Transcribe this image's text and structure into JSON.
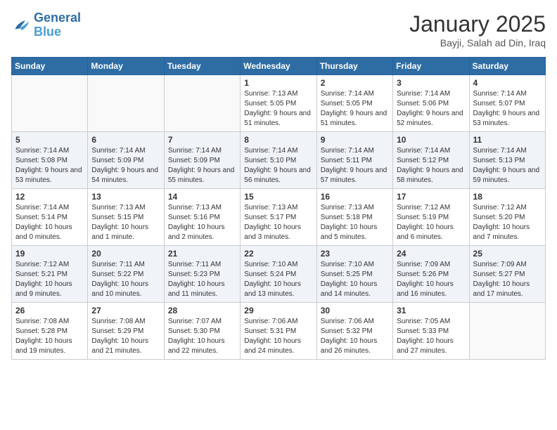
{
  "header": {
    "logo_general": "General",
    "logo_blue": "Blue",
    "month": "January 2025",
    "location": "Bayji, Salah ad Din, Iraq"
  },
  "weekdays": [
    "Sunday",
    "Monday",
    "Tuesday",
    "Wednesday",
    "Thursday",
    "Friday",
    "Saturday"
  ],
  "weeks": [
    [
      {
        "day": "",
        "empty": true
      },
      {
        "day": "",
        "empty": true
      },
      {
        "day": "",
        "empty": true
      },
      {
        "day": "1",
        "sunrise": "7:13 AM",
        "sunset": "5:05 PM",
        "daylight": "9 hours and 51 minutes."
      },
      {
        "day": "2",
        "sunrise": "7:14 AM",
        "sunset": "5:05 PM",
        "daylight": "9 hours and 51 minutes."
      },
      {
        "day": "3",
        "sunrise": "7:14 AM",
        "sunset": "5:06 PM",
        "daylight": "9 hours and 52 minutes."
      },
      {
        "day": "4",
        "sunrise": "7:14 AM",
        "sunset": "5:07 PM",
        "daylight": "9 hours and 53 minutes."
      }
    ],
    [
      {
        "day": "5",
        "sunrise": "7:14 AM",
        "sunset": "5:08 PM",
        "daylight": "9 hours and 53 minutes."
      },
      {
        "day": "6",
        "sunrise": "7:14 AM",
        "sunset": "5:09 PM",
        "daylight": "9 hours and 54 minutes."
      },
      {
        "day": "7",
        "sunrise": "7:14 AM",
        "sunset": "5:09 PM",
        "daylight": "9 hours and 55 minutes."
      },
      {
        "day": "8",
        "sunrise": "7:14 AM",
        "sunset": "5:10 PM",
        "daylight": "9 hours and 56 minutes."
      },
      {
        "day": "9",
        "sunrise": "7:14 AM",
        "sunset": "5:11 PM",
        "daylight": "9 hours and 57 minutes."
      },
      {
        "day": "10",
        "sunrise": "7:14 AM",
        "sunset": "5:12 PM",
        "daylight": "9 hours and 58 minutes."
      },
      {
        "day": "11",
        "sunrise": "7:14 AM",
        "sunset": "5:13 PM",
        "daylight": "9 hours and 59 minutes."
      }
    ],
    [
      {
        "day": "12",
        "sunrise": "7:14 AM",
        "sunset": "5:14 PM",
        "daylight": "10 hours and 0 minutes."
      },
      {
        "day": "13",
        "sunrise": "7:13 AM",
        "sunset": "5:15 PM",
        "daylight": "10 hours and 1 minute."
      },
      {
        "day": "14",
        "sunrise": "7:13 AM",
        "sunset": "5:16 PM",
        "daylight": "10 hours and 2 minutes."
      },
      {
        "day": "15",
        "sunrise": "7:13 AM",
        "sunset": "5:17 PM",
        "daylight": "10 hours and 3 minutes."
      },
      {
        "day": "16",
        "sunrise": "7:13 AM",
        "sunset": "5:18 PM",
        "daylight": "10 hours and 5 minutes."
      },
      {
        "day": "17",
        "sunrise": "7:12 AM",
        "sunset": "5:19 PM",
        "daylight": "10 hours and 6 minutes."
      },
      {
        "day": "18",
        "sunrise": "7:12 AM",
        "sunset": "5:20 PM",
        "daylight": "10 hours and 7 minutes."
      }
    ],
    [
      {
        "day": "19",
        "sunrise": "7:12 AM",
        "sunset": "5:21 PM",
        "daylight": "10 hours and 9 minutes."
      },
      {
        "day": "20",
        "sunrise": "7:11 AM",
        "sunset": "5:22 PM",
        "daylight": "10 hours and 10 minutes."
      },
      {
        "day": "21",
        "sunrise": "7:11 AM",
        "sunset": "5:23 PM",
        "daylight": "10 hours and 11 minutes."
      },
      {
        "day": "22",
        "sunrise": "7:10 AM",
        "sunset": "5:24 PM",
        "daylight": "10 hours and 13 minutes."
      },
      {
        "day": "23",
        "sunrise": "7:10 AM",
        "sunset": "5:25 PM",
        "daylight": "10 hours and 14 minutes."
      },
      {
        "day": "24",
        "sunrise": "7:09 AM",
        "sunset": "5:26 PM",
        "daylight": "10 hours and 16 minutes."
      },
      {
        "day": "25",
        "sunrise": "7:09 AM",
        "sunset": "5:27 PM",
        "daylight": "10 hours and 17 minutes."
      }
    ],
    [
      {
        "day": "26",
        "sunrise": "7:08 AM",
        "sunset": "5:28 PM",
        "daylight": "10 hours and 19 minutes."
      },
      {
        "day": "27",
        "sunrise": "7:08 AM",
        "sunset": "5:29 PM",
        "daylight": "10 hours and 21 minutes."
      },
      {
        "day": "28",
        "sunrise": "7:07 AM",
        "sunset": "5:30 PM",
        "daylight": "10 hours and 22 minutes."
      },
      {
        "day": "29",
        "sunrise": "7:06 AM",
        "sunset": "5:31 PM",
        "daylight": "10 hours and 24 minutes."
      },
      {
        "day": "30",
        "sunrise": "7:06 AM",
        "sunset": "5:32 PM",
        "daylight": "10 hours and 26 minutes."
      },
      {
        "day": "31",
        "sunrise": "7:05 AM",
        "sunset": "5:33 PM",
        "daylight": "10 hours and 27 minutes."
      },
      {
        "day": "",
        "empty": true
      }
    ]
  ]
}
